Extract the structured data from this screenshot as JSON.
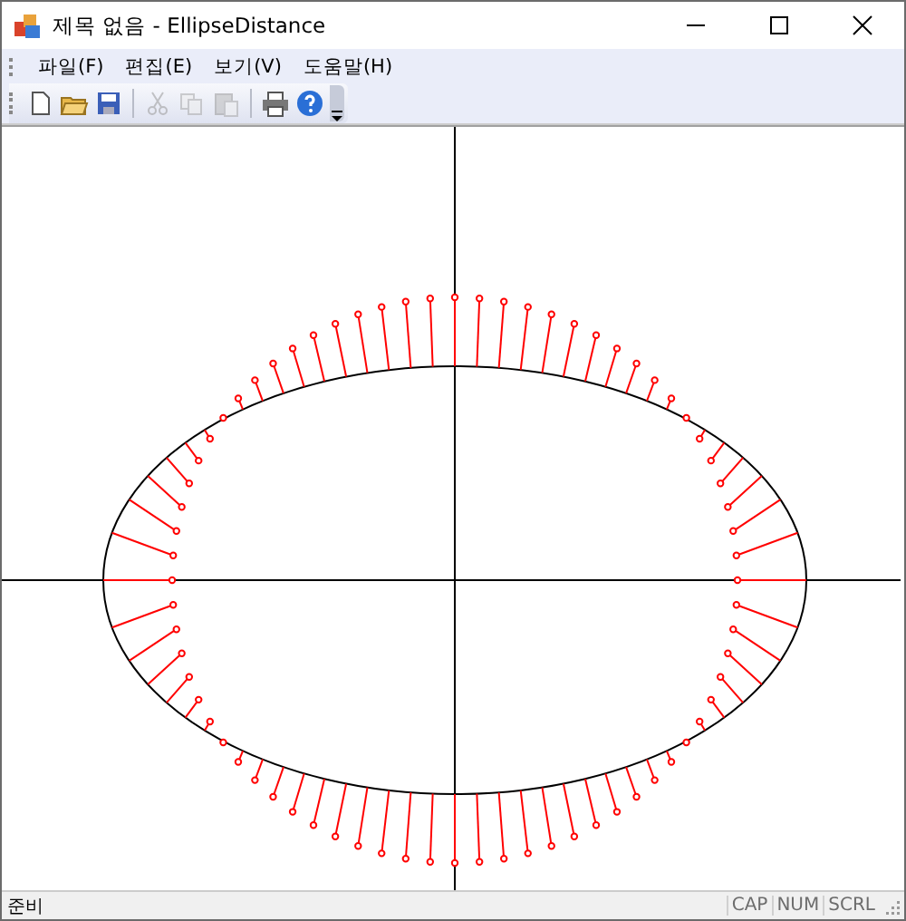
{
  "window": {
    "title": "제목 없음 - EllipseDistance"
  },
  "menu": [
    {
      "label": "파일(F)"
    },
    {
      "label": "편집(E)"
    },
    {
      "label": "보기(V)"
    },
    {
      "label": "도움말(H)"
    }
  ],
  "toolbar": [
    {
      "kind": "new",
      "disabled": false
    },
    {
      "kind": "open",
      "disabled": false
    },
    {
      "kind": "save",
      "disabled": false
    },
    {
      "kind": "separator"
    },
    {
      "kind": "cut",
      "disabled": true
    },
    {
      "kind": "copy",
      "disabled": true
    },
    {
      "kind": "paste",
      "disabled": true
    },
    {
      "kind": "separator"
    },
    {
      "kind": "print",
      "disabled": false
    },
    {
      "kind": "help",
      "disabled": false
    }
  ],
  "status_bar": {
    "message": "준비",
    "indicators": [
      {
        "label": "CAP",
        "on": false
      },
      {
        "label": "NUM",
        "on": false
      },
      {
        "label": "SCRL",
        "on": false
      }
    ]
  }
}
